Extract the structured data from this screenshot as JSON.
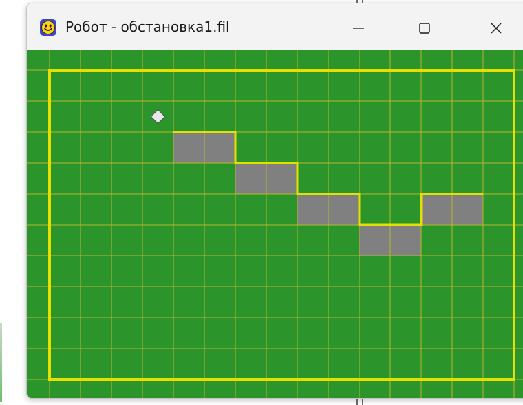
{
  "window": {
    "title": "Робот - обстановка1.fil",
    "icon": "smiley-face-icon",
    "controls": [
      "minimize-icon",
      "maximize-icon",
      "close-icon"
    ]
  },
  "field": {
    "colors": {
      "background": "#2b942b",
      "grid": "#b8b82a",
      "wall": "#e6e000",
      "painted": "#808080",
      "robot": "#e8e8e8"
    },
    "columns": 15,
    "rows": 10,
    "painted_cells": [
      {
        "col": 4,
        "row": 2
      },
      {
        "col": 5,
        "row": 2
      },
      {
        "col": 6,
        "row": 3
      },
      {
        "col": 7,
        "row": 3
      },
      {
        "col": 8,
        "row": 4
      },
      {
        "col": 9,
        "row": 4
      },
      {
        "col": 12,
        "row": 4
      },
      {
        "col": 13,
        "row": 4
      },
      {
        "col": 10,
        "row": 5
      },
      {
        "col": 11,
        "row": 5
      }
    ],
    "robot": {
      "col": 3,
      "row": 1
    }
  }
}
